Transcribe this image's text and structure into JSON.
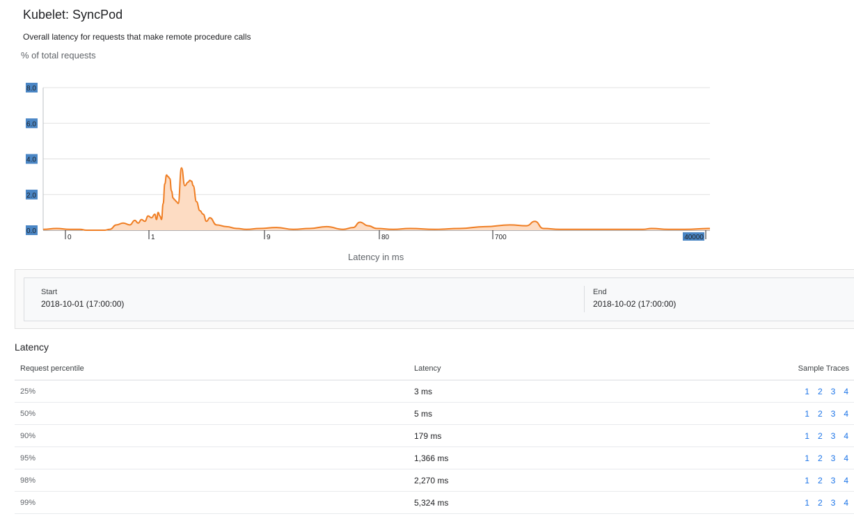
{
  "page": {
    "title": "Kubelet: SyncPod",
    "subtitle": "Overall latency for requests that make remote procedure calls",
    "y_axis_label": "% of total requests",
    "x_axis_label": "Latency in ms"
  },
  "chart_data": {
    "type": "area",
    "ylabel": "% of total requests",
    "xlabel": "Latency in ms",
    "ylim": [
      0,
      8
    ],
    "y_ticks": [
      "0.0",
      "2.0",
      "4.0",
      "6.0",
      "8.0"
    ],
    "x_ticks": [
      "0",
      "1",
      "9",
      "80",
      "700",
      "40000"
    ],
    "grid": true,
    "line_color": "#ef7d22",
    "fill_color": "#fddcc3",
    "bucket_positions": [
      0,
      8,
      16,
      22,
      26,
      30,
      34,
      37,
      40,
      44,
      48,
      52,
      55,
      57,
      59,
      61,
      63,
      65,
      67,
      68,
      69,
      70,
      71,
      72,
      73,
      74,
      75,
      76,
      77,
      78,
      79,
      80,
      81,
      83,
      85,
      87,
      88,
      89,
      90,
      92,
      94,
      96,
      98,
      100,
      104,
      110,
      116,
      122,
      130,
      140,
      150,
      160,
      170,
      180,
      186,
      190,
      195,
      200,
      210,
      220,
      235,
      250,
      265,
      280,
      290,
      295,
      300,
      310,
      320,
      335,
      350,
      360,
      365,
      375,
      385,
      400
    ],
    "values": [
      0.05,
      0.1,
      0.05,
      0.05,
      0.0,
      0.0,
      0.0,
      0.0,
      0.05,
      0.3,
      0.4,
      0.3,
      0.55,
      0.4,
      0.6,
      0.5,
      0.8,
      0.7,
      0.9,
      0.6,
      1.0,
      0.8,
      0.6,
      1.5,
      2.6,
      3.1,
      3.0,
      2.9,
      2.2,
      1.8,
      1.7,
      1.6,
      1.5,
      3.5,
      2.5,
      2.7,
      2.8,
      2.75,
      2.5,
      1.6,
      1.1,
      0.9,
      0.5,
      0.7,
      0.3,
      0.2,
      0.1,
      0.05,
      0.1,
      0.15,
      0.05,
      0.1,
      0.2,
      0.05,
      0.15,
      0.45,
      0.25,
      0.1,
      0.05,
      0.1,
      0.05,
      0.1,
      0.2,
      0.3,
      0.25,
      0.5,
      0.1,
      0.05,
      0.05,
      0.05,
      0.05,
      0.05,
      0.1,
      0.05,
      0.05,
      0.1
    ]
  },
  "range": {
    "start_label": "Start",
    "start_value": "2018-10-01 (17:00:00)",
    "end_label": "End",
    "end_value": "2018-10-02 (17:00:00)"
  },
  "latency": {
    "section_title": "Latency",
    "headers": [
      "Request percentile",
      "Latency",
      "Sample Traces"
    ],
    "rows": [
      {
        "percentile": "25%",
        "latency": "3 ms",
        "traces": [
          "1",
          "2",
          "3",
          "4"
        ]
      },
      {
        "percentile": "50%",
        "latency": "5 ms",
        "traces": [
          "1",
          "2",
          "3",
          "4"
        ]
      },
      {
        "percentile": "90%",
        "latency": "179 ms",
        "traces": [
          "1",
          "2",
          "3",
          "4"
        ]
      },
      {
        "percentile": "95%",
        "latency": "1,366 ms",
        "traces": [
          "1",
          "2",
          "3",
          "4"
        ]
      },
      {
        "percentile": "98%",
        "latency": "2,270 ms",
        "traces": [
          "1",
          "2",
          "3",
          "4"
        ]
      },
      {
        "percentile": "99%",
        "latency": "5,324 ms",
        "traces": [
          "1",
          "2",
          "3",
          "4"
        ]
      }
    ]
  }
}
